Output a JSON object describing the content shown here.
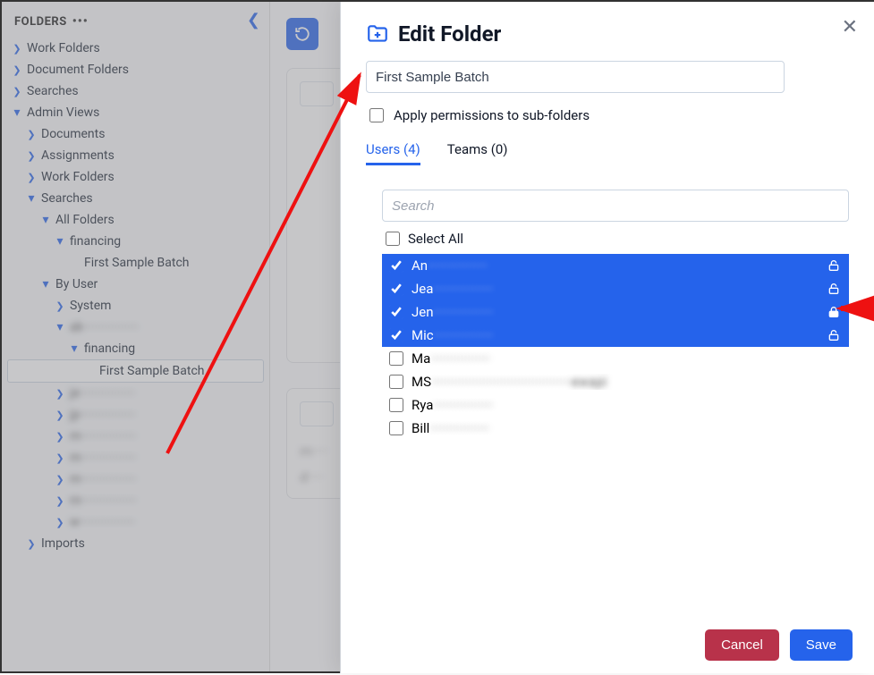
{
  "sidebar": {
    "title": "FOLDERS",
    "items": [
      {
        "label": "Work Folders",
        "indent": 0,
        "expanded": false
      },
      {
        "label": "Document Folders",
        "indent": 0,
        "expanded": false
      },
      {
        "label": "Searches",
        "indent": 0,
        "expanded": false
      },
      {
        "label": "Admin Views",
        "indent": 0,
        "expanded": true
      },
      {
        "label": "Documents",
        "indent": 1,
        "expanded": false
      },
      {
        "label": "Assignments",
        "indent": 1,
        "expanded": false
      },
      {
        "label": "Work Folders",
        "indent": 1,
        "expanded": false
      },
      {
        "label": "Searches",
        "indent": 1,
        "expanded": true
      },
      {
        "label": "All Folders",
        "indent": 2,
        "expanded": true
      },
      {
        "label": "financing",
        "indent": 3,
        "expanded": true
      },
      {
        "label": "First Sample Batch",
        "indent": 4,
        "expanded": null
      },
      {
        "label": "By User",
        "indent": 2,
        "expanded": true
      },
      {
        "label": "System",
        "indent": 3,
        "expanded": false
      },
      {
        "label": "ak·················",
        "indent": 3,
        "expanded": true,
        "blurred": true
      },
      {
        "label": "financing",
        "indent": 4,
        "expanded": true
      },
      {
        "label": "First Sample Batch",
        "indent": 5,
        "expanded": null,
        "selected": true
      },
      {
        "label": "je·················",
        "indent": 3,
        "expanded": false,
        "blurred": true
      },
      {
        "label": "jp·················",
        "indent": 3,
        "expanded": false,
        "blurred": true
      },
      {
        "label": "m·················",
        "indent": 3,
        "expanded": false,
        "blurred": true
      },
      {
        "label": "m·················",
        "indent": 3,
        "expanded": false,
        "blurred": true
      },
      {
        "label": "m·················",
        "indent": 3,
        "expanded": false,
        "blurred": true
      },
      {
        "label": "rn·················",
        "indent": 3,
        "expanded": false,
        "blurred": true
      },
      {
        "label": "w·················",
        "indent": 3,
        "expanded": false,
        "blurred": true
      },
      {
        "label": "Imports",
        "indent": 1,
        "expanded": false
      }
    ]
  },
  "modal": {
    "title": "Edit Folder",
    "folder_name": "First Sample Batch",
    "apply_sub_label": "Apply permissions to sub-folders",
    "tabs": {
      "users": {
        "label": "Users (4)",
        "active": true
      },
      "teams": {
        "label": "Teams (0)",
        "active": false
      }
    },
    "search_placeholder": "Search",
    "select_all_label": "Select All",
    "users": [
      {
        "prefix": "An",
        "rest": "·················",
        "checked": true,
        "lock": "unlocked"
      },
      {
        "prefix": "Jea",
        "rest": "·················",
        "checked": true,
        "lock": "unlocked"
      },
      {
        "prefix": "Jen",
        "rest": "·················",
        "checked": true,
        "lock": "locked"
      },
      {
        "prefix": "Mic",
        "rest": "·················",
        "checked": true,
        "lock": "unlocked"
      },
      {
        "prefix": "Ma",
        "rest": "·················",
        "checked": false
      },
      {
        "prefix": "MS",
        "rest": "········································ewapi",
        "checked": false
      },
      {
        "prefix": "Rya",
        "rest": "·················",
        "checked": false
      },
      {
        "prefix": "Bill",
        "rest": "·················",
        "checked": false
      }
    ],
    "cancel_label": "Cancel",
    "save_label": "Save"
  }
}
